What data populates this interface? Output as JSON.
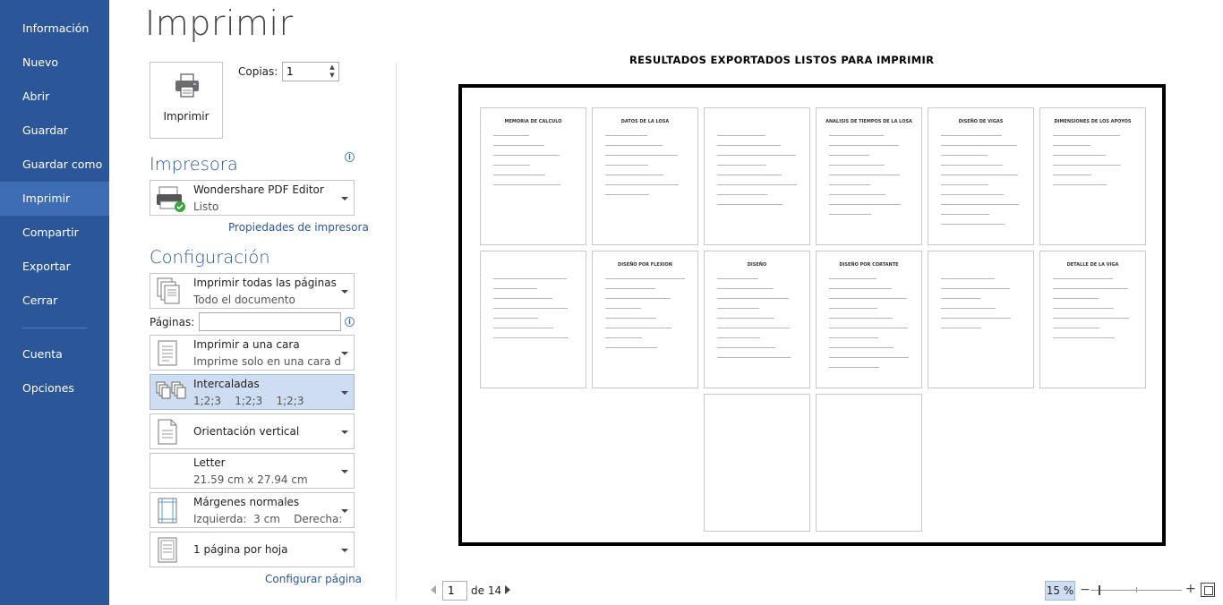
{
  "nav": {
    "items": [
      {
        "id": "info",
        "label": "Información"
      },
      {
        "id": "new",
        "label": "Nuevo"
      },
      {
        "id": "open",
        "label": "Abrir"
      },
      {
        "id": "save",
        "label": "Guardar"
      },
      {
        "id": "save-as",
        "label": "Guardar como"
      },
      {
        "id": "print",
        "label": "Imprimir"
      },
      {
        "id": "share",
        "label": "Compartir"
      },
      {
        "id": "export",
        "label": "Exportar"
      },
      {
        "id": "close",
        "label": "Cerrar"
      },
      {
        "id": "account",
        "label": "Cuenta"
      },
      {
        "id": "options",
        "label": "Opciones"
      }
    ],
    "active": "Imprimir"
  },
  "page_title": "Imprimir",
  "print_button": {
    "label": "Imprimir",
    "icon": "printer-icon"
  },
  "copies": {
    "label": "Copias:",
    "value": "1"
  },
  "printer_section": {
    "title": "Impresora",
    "printer_name": "Wondershare PDF Editor",
    "printer_status": "Listo",
    "properties_link": "Propiedades de impresora"
  },
  "settings_section": {
    "title": "Configuración",
    "pages_label": "Páginas:",
    "pages_value": "",
    "options": [
      {
        "id": "range",
        "line1": "Imprimir todas las páginas",
        "line2": "Todo el documento"
      },
      {
        "id": "sides",
        "line1": "Imprimir a una cara",
        "line2": "Imprime solo en una cara de..."
      },
      {
        "id": "collate",
        "line1": "Intercaladas",
        "line2": "1;2;3    1;2;3    1;2;3"
      },
      {
        "id": "orientation",
        "line1": "Orientación vertical",
        "line2": ""
      },
      {
        "id": "paper",
        "line1": "Letter",
        "line2": "21.59 cm x 27.94 cm"
      },
      {
        "id": "margins",
        "line1": "Márgenes normales",
        "line2": "Izquierda:  3 cm    Derecha:..."
      },
      {
        "id": "per-sheet",
        "line1": "1 página por hoja",
        "line2": ""
      }
    ],
    "page_setup_link": "Configurar página"
  },
  "preview": {
    "heading": "RESULTADOS EXPORTADOS LISTOS PARA IMPRIMIR",
    "thumbnails": [
      {
        "title": "MEMORIA DE CALCULO"
      },
      {
        "title": "DATOS DE LA LOSA"
      },
      {
        "title": ""
      },
      {
        "title": "ANALISIS DE TIEMPOS DE LA LOSA"
      },
      {
        "title": "DISEÑO DE VIGAS"
      },
      {
        "title": "DIMENSIONES DE LOS APOYOS"
      },
      {
        "title": ""
      },
      {
        "title": "DISEÑO POR FLEXION"
      },
      {
        "title": "DISEÑO"
      },
      {
        "title": "DISEÑO POR CORTANTE"
      },
      {
        "title": ""
      },
      {
        "title": "DETALLE DE LA VIGA"
      },
      {
        "title": ""
      },
      {
        "title": ""
      }
    ]
  },
  "pager": {
    "current": "1",
    "of_label": "de 14"
  },
  "zoom": {
    "percent": "15 %"
  }
}
